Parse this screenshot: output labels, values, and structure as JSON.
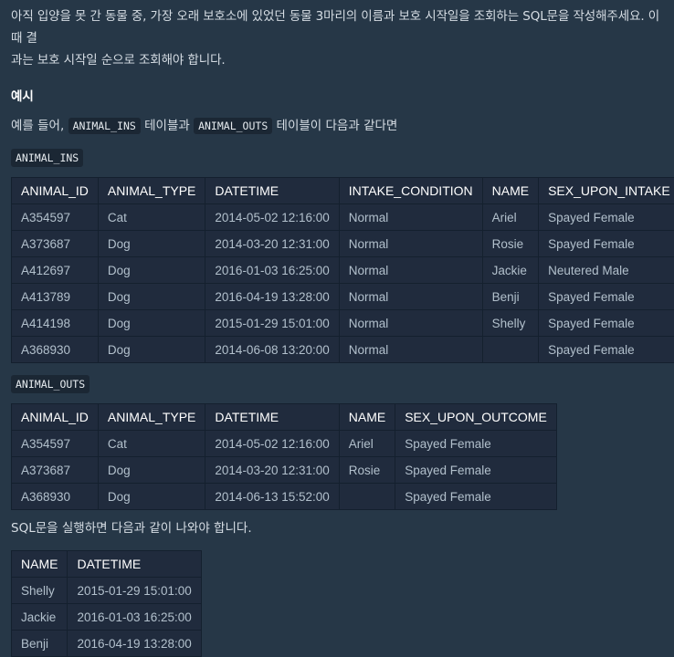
{
  "intro": {
    "line1": "아직 입양을 못 간 동물 중, 가장 오래 보호소에 있었던 동물 3마리의 이름과 보호 시작일을 조회하는 SQL문을 작성해주세요. 이때 결",
    "line2": "과는 보호 시작일 순으로 조회해야 합니다."
  },
  "example": {
    "heading": "예시",
    "prefix": "예를 들어, ",
    "code1": "ANIMAL_INS",
    "middle": " 테이블과 ",
    "code2": "ANIMAL_OUTS",
    "suffix": " 테이블이 다음과 같다면"
  },
  "animal_ins": {
    "label": "ANIMAL_INS",
    "columns": [
      "ANIMAL_ID",
      "ANIMAL_TYPE",
      "DATETIME",
      "INTAKE_CONDITION",
      "NAME",
      "SEX_UPON_INTAKE"
    ],
    "rows": [
      [
        "A354597",
        "Cat",
        "2014-05-02 12:16:00",
        "Normal",
        "Ariel",
        "Spayed Female"
      ],
      [
        "A373687",
        "Dog",
        "2014-03-20 12:31:00",
        "Normal",
        "Rosie",
        "Spayed Female"
      ],
      [
        "A412697",
        "Dog",
        "2016-01-03 16:25:00",
        "Normal",
        "Jackie",
        "Neutered Male"
      ],
      [
        "A413789",
        "Dog",
        "2016-04-19 13:28:00",
        "Normal",
        "Benji",
        "Spayed Female"
      ],
      [
        "A414198",
        "Dog",
        "2015-01-29 15:01:00",
        "Normal",
        "Shelly",
        "Spayed Female"
      ],
      [
        "A368930",
        "Dog",
        "2014-06-08 13:20:00",
        "Normal",
        "",
        "Spayed Female"
      ]
    ]
  },
  "animal_outs": {
    "label": "ANIMAL_OUTS",
    "columns": [
      "ANIMAL_ID",
      "ANIMAL_TYPE",
      "DATETIME",
      "NAME",
      "SEX_UPON_OUTCOME"
    ],
    "rows": [
      [
        "A354597",
        "Cat",
        "2014-05-02 12:16:00",
        "Ariel",
        "Spayed Female"
      ],
      [
        "A373687",
        "Dog",
        "2014-03-20 12:31:00",
        "Rosie",
        "Spayed Female"
      ],
      [
        "A368930",
        "Dog",
        "2014-06-13 15:52:00",
        "",
        "Spayed Female"
      ]
    ]
  },
  "result": {
    "text": "SQL문을 실행하면 다음과 같이 나와야 합니다.",
    "columns": [
      "NAME",
      "DATETIME"
    ],
    "rows": [
      [
        "Shelly",
        "2015-01-29 15:01:00"
      ],
      [
        "Jackie",
        "2016-01-03 16:25:00"
      ],
      [
        "Benji",
        "2016-04-19 13:28:00"
      ]
    ]
  },
  "colors": {
    "background": "#263747",
    "table_background": "#202b3d",
    "table_border": "#14202e",
    "header_text": "#ffffff",
    "cell_text": "#b2c0cc",
    "code_background": "#1b2734"
  }
}
